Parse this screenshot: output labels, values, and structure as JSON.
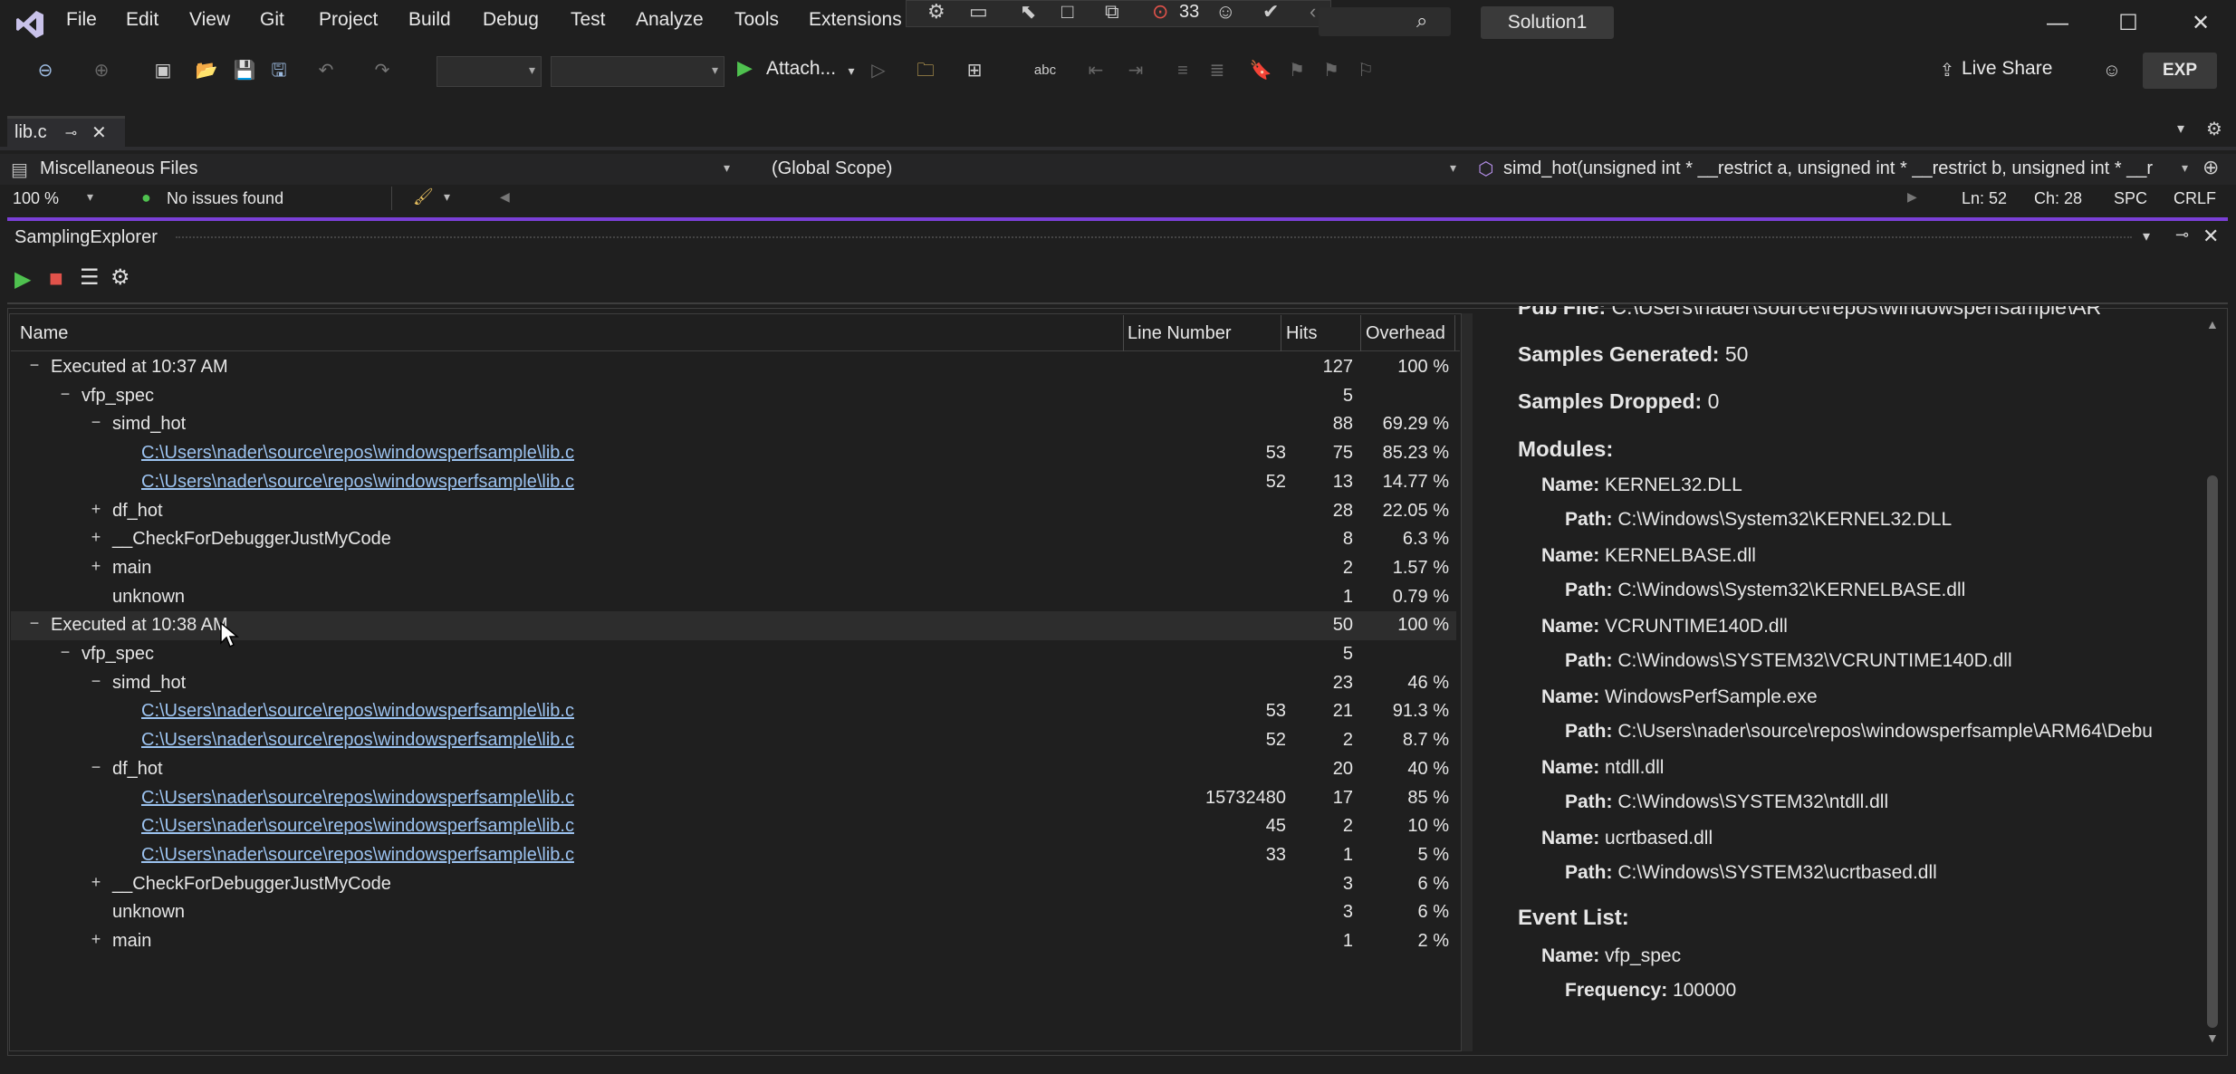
{
  "menu": [
    "File",
    "Edit",
    "View",
    "Git",
    "Project",
    "Build",
    "Debug",
    "Test",
    "Analyze",
    "Tools",
    "Extensions"
  ],
  "title_bar": {
    "solution": "Solution1",
    "notif_count": "33"
  },
  "toolbar": {
    "attach_label": "Attach...",
    "live_share": "Live Share",
    "exp_badge": "EXP"
  },
  "doc_tab": {
    "name": "lib.c"
  },
  "nav": {
    "project": "Miscellaneous Files",
    "scope": "(Global Scope)",
    "member": "simd_hot(unsigned int * __restrict a, unsigned int * __restrict b, unsigned int * __r"
  },
  "status_strip": {
    "zoom": "100 %",
    "issues": "No issues found",
    "line": "Ln: 52",
    "col": "Ch: 28",
    "spacing": "SPC",
    "eol": "CRLF"
  },
  "tool_window": {
    "title": "SamplingExplorer"
  },
  "grid": {
    "columns": {
      "name": "Name",
      "line": "Line Number",
      "hits": "Hits",
      "overhead": "Overhead"
    },
    "rows": [
      {
        "toggle": "−",
        "name": "Executed at 10:37 AM",
        "line": "",
        "hits": "127",
        "overhead": "100 %"
      },
      {
        "toggle": "−",
        "name": "vfp_spec",
        "line": "",
        "hits": "5",
        "overhead": ""
      },
      {
        "toggle": "−",
        "name": "simd_hot",
        "line": "",
        "hits": "88",
        "overhead": "69.29 %"
      },
      {
        "toggle": "",
        "name": "C:\\Users\\nader\\source\\repos\\windowsperfsample\\lib.c",
        "line": "53",
        "hits": "75",
        "overhead": "85.23 %"
      },
      {
        "toggle": "",
        "name": "C:\\Users\\nader\\source\\repos\\windowsperfsample\\lib.c",
        "line": "52",
        "hits": "13",
        "overhead": "14.77 %"
      },
      {
        "toggle": "+",
        "name": "df_hot",
        "line": "",
        "hits": "28",
        "overhead": "22.05 %"
      },
      {
        "toggle": "+",
        "name": "__CheckForDebuggerJustMyCode",
        "line": "",
        "hits": "8",
        "overhead": "6.3 %"
      },
      {
        "toggle": "+",
        "name": "main",
        "line": "",
        "hits": "2",
        "overhead": "1.57 %"
      },
      {
        "toggle": "",
        "name": "unknown",
        "line": "",
        "hits": "1",
        "overhead": "0.79 %"
      },
      {
        "toggle": "−",
        "name": "Executed at 10:38 AM",
        "line": "",
        "hits": "50",
        "overhead": "100 %"
      },
      {
        "toggle": "−",
        "name": "vfp_spec",
        "line": "",
        "hits": "5",
        "overhead": ""
      },
      {
        "toggle": "−",
        "name": "simd_hot",
        "line": "",
        "hits": "23",
        "overhead": "46 %"
      },
      {
        "toggle": "",
        "name": "C:\\Users\\nader\\source\\repos\\windowsperfsample\\lib.c",
        "line": "53",
        "hits": "21",
        "overhead": "91.3 %"
      },
      {
        "toggle": "",
        "name": "C:\\Users\\nader\\source\\repos\\windowsperfsample\\lib.c",
        "line": "52",
        "hits": "2",
        "overhead": "8.7 %"
      },
      {
        "toggle": "−",
        "name": "df_hot",
        "line": "",
        "hits": "20",
        "overhead": "40 %"
      },
      {
        "toggle": "",
        "name": "C:\\Users\\nader\\source\\repos\\windowsperfsample\\lib.c",
        "line": "15732480",
        "hits": "17",
        "overhead": "85 %"
      },
      {
        "toggle": "",
        "name": "C:\\Users\\nader\\source\\repos\\windowsperfsample\\lib.c",
        "line": "45",
        "hits": "2",
        "overhead": "10 %"
      },
      {
        "toggle": "",
        "name": "C:\\Users\\nader\\source\\repos\\windowsperfsample\\lib.c",
        "line": "33",
        "hits": "1",
        "overhead": "5 %"
      },
      {
        "toggle": "+",
        "name": "__CheckForDebuggerJustMyCode",
        "line": "",
        "hits": "3",
        "overhead": "6 %"
      },
      {
        "toggle": "",
        "name": "unknown",
        "line": "",
        "hits": "3",
        "overhead": "6 %"
      },
      {
        "toggle": "+",
        "name": "main",
        "line": "",
        "hits": "1",
        "overhead": "2 %"
      }
    ]
  },
  "details": {
    "pdb_file_label": "Pdb File:",
    "pdb_file_value": "C:\\Users\\nader\\source\\repos\\windowsperfsample\\AR",
    "samples_generated_label": "Samples Generated:",
    "samples_generated_value": "50",
    "samples_dropped_label": "Samples Dropped:",
    "samples_dropped_value": "0",
    "modules_label": "Modules:",
    "name_label": "Name:",
    "path_label": "Path:",
    "modules": [
      {
        "name": "KERNEL32.DLL",
        "path": "C:\\Windows\\System32\\KERNEL32.DLL"
      },
      {
        "name": "KERNELBASE.dll",
        "path": "C:\\Windows\\System32\\KERNELBASE.dll"
      },
      {
        "name": "VCRUNTIME140D.dll",
        "path": "C:\\Windows\\SYSTEM32\\VCRUNTIME140D.dll"
      },
      {
        "name": "WindowsPerfSample.exe",
        "path": "C:\\Users\\nader\\source\\repos\\windowsperfsample\\ARM64\\Debu"
      },
      {
        "name": "ntdll.dll",
        "path": "C:\\Windows\\SYSTEM32\\ntdll.dll"
      },
      {
        "name": "ucrtbased.dll",
        "path": "C:\\Windows\\SYSTEM32\\ucrtbased.dll"
      }
    ],
    "event_list_label": "Event List:",
    "event_name": "vfp_spec",
    "frequency_label": "Frequency:",
    "frequency_value": "100000"
  }
}
